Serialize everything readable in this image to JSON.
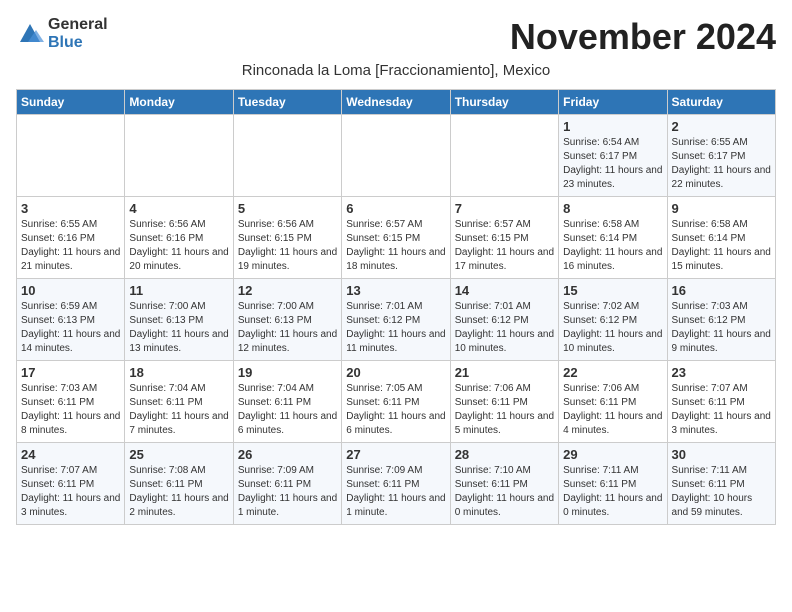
{
  "logo": {
    "general": "General",
    "blue": "Blue"
  },
  "title": "November 2024",
  "location": "Rinconada la Loma [Fraccionamiento], Mexico",
  "headers": [
    "Sunday",
    "Monday",
    "Tuesday",
    "Wednesday",
    "Thursday",
    "Friday",
    "Saturday"
  ],
  "weeks": [
    [
      {
        "day": "",
        "info": ""
      },
      {
        "day": "",
        "info": ""
      },
      {
        "day": "",
        "info": ""
      },
      {
        "day": "",
        "info": ""
      },
      {
        "day": "",
        "info": ""
      },
      {
        "day": "1",
        "info": "Sunrise: 6:54 AM\nSunset: 6:17 PM\nDaylight: 11 hours and 23 minutes."
      },
      {
        "day": "2",
        "info": "Sunrise: 6:55 AM\nSunset: 6:17 PM\nDaylight: 11 hours and 22 minutes."
      }
    ],
    [
      {
        "day": "3",
        "info": "Sunrise: 6:55 AM\nSunset: 6:16 PM\nDaylight: 11 hours and 21 minutes."
      },
      {
        "day": "4",
        "info": "Sunrise: 6:56 AM\nSunset: 6:16 PM\nDaylight: 11 hours and 20 minutes."
      },
      {
        "day": "5",
        "info": "Sunrise: 6:56 AM\nSunset: 6:15 PM\nDaylight: 11 hours and 19 minutes."
      },
      {
        "day": "6",
        "info": "Sunrise: 6:57 AM\nSunset: 6:15 PM\nDaylight: 11 hours and 18 minutes."
      },
      {
        "day": "7",
        "info": "Sunrise: 6:57 AM\nSunset: 6:15 PM\nDaylight: 11 hours and 17 minutes."
      },
      {
        "day": "8",
        "info": "Sunrise: 6:58 AM\nSunset: 6:14 PM\nDaylight: 11 hours and 16 minutes."
      },
      {
        "day": "9",
        "info": "Sunrise: 6:58 AM\nSunset: 6:14 PM\nDaylight: 11 hours and 15 minutes."
      }
    ],
    [
      {
        "day": "10",
        "info": "Sunrise: 6:59 AM\nSunset: 6:13 PM\nDaylight: 11 hours and 14 minutes."
      },
      {
        "day": "11",
        "info": "Sunrise: 7:00 AM\nSunset: 6:13 PM\nDaylight: 11 hours and 13 minutes."
      },
      {
        "day": "12",
        "info": "Sunrise: 7:00 AM\nSunset: 6:13 PM\nDaylight: 11 hours and 12 minutes."
      },
      {
        "day": "13",
        "info": "Sunrise: 7:01 AM\nSunset: 6:12 PM\nDaylight: 11 hours and 11 minutes."
      },
      {
        "day": "14",
        "info": "Sunrise: 7:01 AM\nSunset: 6:12 PM\nDaylight: 11 hours and 10 minutes."
      },
      {
        "day": "15",
        "info": "Sunrise: 7:02 AM\nSunset: 6:12 PM\nDaylight: 11 hours and 10 minutes."
      },
      {
        "day": "16",
        "info": "Sunrise: 7:03 AM\nSunset: 6:12 PM\nDaylight: 11 hours and 9 minutes."
      }
    ],
    [
      {
        "day": "17",
        "info": "Sunrise: 7:03 AM\nSunset: 6:11 PM\nDaylight: 11 hours and 8 minutes."
      },
      {
        "day": "18",
        "info": "Sunrise: 7:04 AM\nSunset: 6:11 PM\nDaylight: 11 hours and 7 minutes."
      },
      {
        "day": "19",
        "info": "Sunrise: 7:04 AM\nSunset: 6:11 PM\nDaylight: 11 hours and 6 minutes."
      },
      {
        "day": "20",
        "info": "Sunrise: 7:05 AM\nSunset: 6:11 PM\nDaylight: 11 hours and 6 minutes."
      },
      {
        "day": "21",
        "info": "Sunrise: 7:06 AM\nSunset: 6:11 PM\nDaylight: 11 hours and 5 minutes."
      },
      {
        "day": "22",
        "info": "Sunrise: 7:06 AM\nSunset: 6:11 PM\nDaylight: 11 hours and 4 minutes."
      },
      {
        "day": "23",
        "info": "Sunrise: 7:07 AM\nSunset: 6:11 PM\nDaylight: 11 hours and 3 minutes."
      }
    ],
    [
      {
        "day": "24",
        "info": "Sunrise: 7:07 AM\nSunset: 6:11 PM\nDaylight: 11 hours and 3 minutes."
      },
      {
        "day": "25",
        "info": "Sunrise: 7:08 AM\nSunset: 6:11 PM\nDaylight: 11 hours and 2 minutes."
      },
      {
        "day": "26",
        "info": "Sunrise: 7:09 AM\nSunset: 6:11 PM\nDaylight: 11 hours and 1 minute."
      },
      {
        "day": "27",
        "info": "Sunrise: 7:09 AM\nSunset: 6:11 PM\nDaylight: 11 hours and 1 minute."
      },
      {
        "day": "28",
        "info": "Sunrise: 7:10 AM\nSunset: 6:11 PM\nDaylight: 11 hours and 0 minutes."
      },
      {
        "day": "29",
        "info": "Sunrise: 7:11 AM\nSunset: 6:11 PM\nDaylight: 11 hours and 0 minutes."
      },
      {
        "day": "30",
        "info": "Sunrise: 7:11 AM\nSunset: 6:11 PM\nDaylight: 10 hours and 59 minutes."
      }
    ]
  ]
}
